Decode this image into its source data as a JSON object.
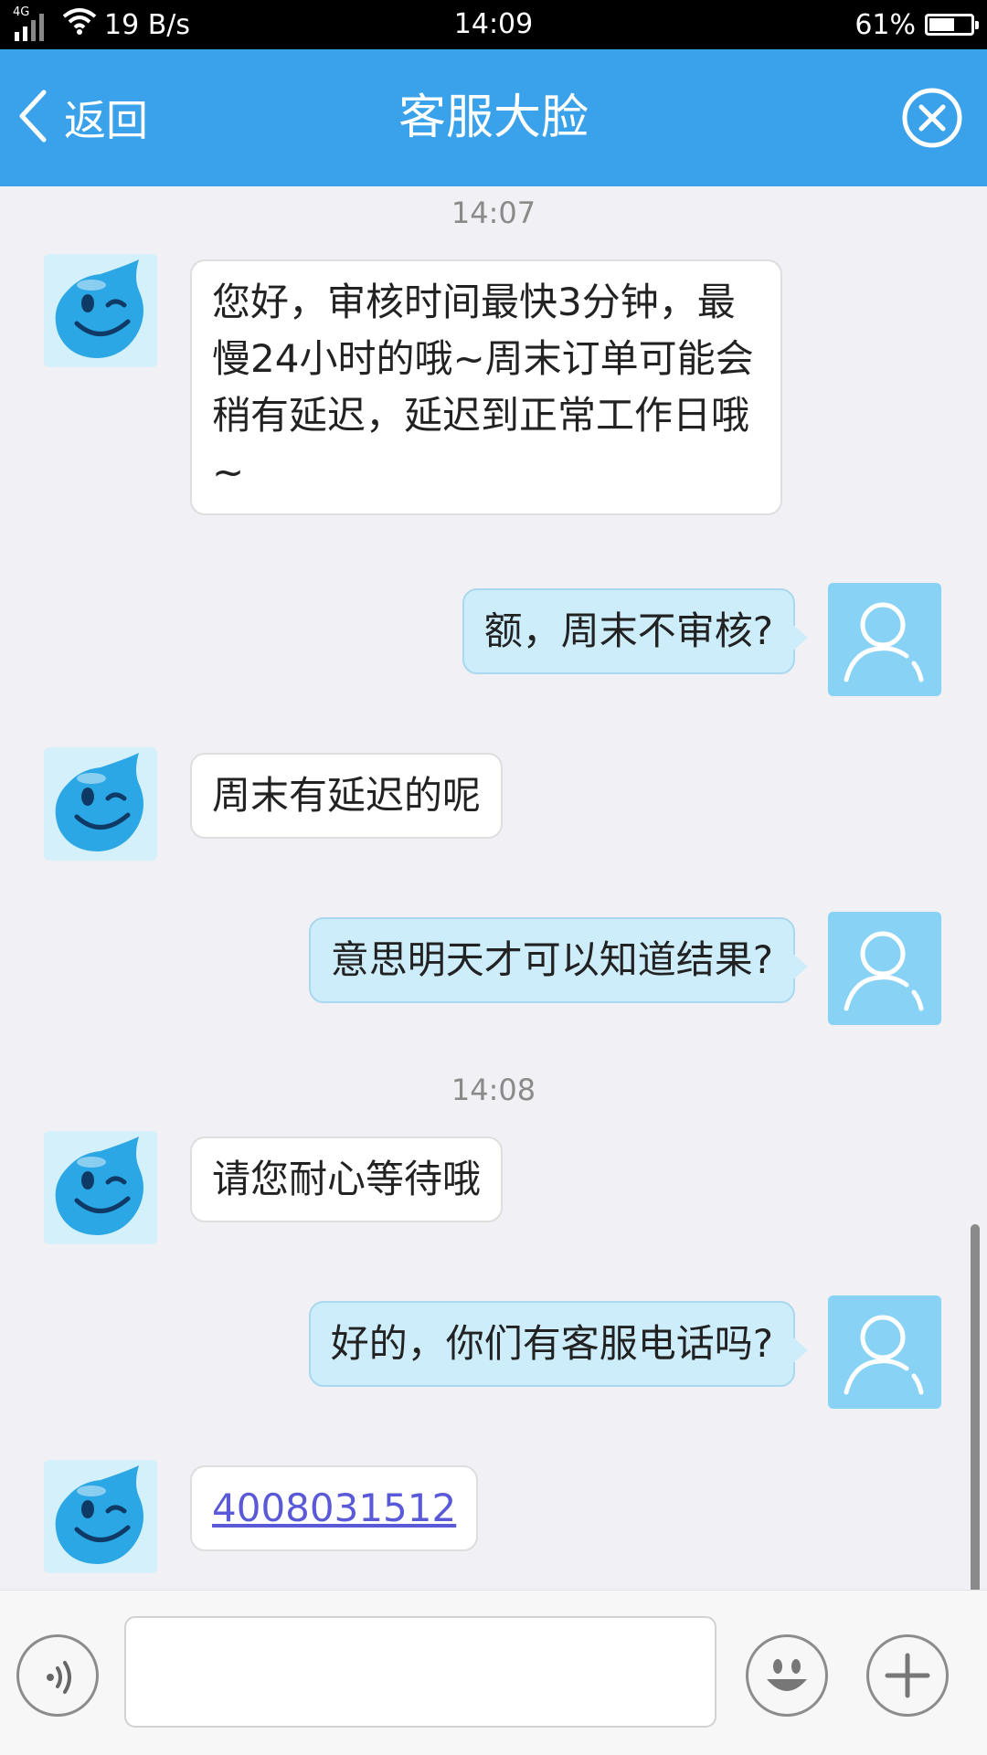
{
  "status_bar": {
    "network": "4G",
    "speed": "19 B/s",
    "time": "14:09",
    "battery_text": "61%",
    "battery_level": 0.61
  },
  "nav": {
    "back_label": "返回",
    "title": "客服大脸",
    "close_icon": "close-circle-icon",
    "color": "#3aa2ea"
  },
  "chat": {
    "timestamps": [
      "14:07",
      "14:08"
    ],
    "messages": [
      {
        "from": "agent",
        "text": "您好，审核时间最快3分钟，最慢24小时的哦~周末订单可能会稍有延迟，延迟到正常工作日哦~"
      },
      {
        "from": "user",
        "text": "额，周末不审核?"
      },
      {
        "from": "agent",
        "text": "周末有延迟的呢"
      },
      {
        "from": "user",
        "text": "意思明天才可以知道结果?"
      },
      {
        "from": "agent",
        "text": "请您耐心等待哦"
      },
      {
        "from": "user",
        "text": "好的，你们有客服电话吗?"
      },
      {
        "from": "agent",
        "text": "4008031512",
        "is_link": true
      }
    ],
    "colors": {
      "user_bubble": "#cdedfb",
      "agent_bubble": "#ffffff",
      "link": "#5a5ad8"
    }
  },
  "input_bar": {
    "voice_icon": "voice-icon",
    "text_value": "",
    "emoji_icon": "emoji-icon",
    "add_icon": "plus-icon"
  }
}
